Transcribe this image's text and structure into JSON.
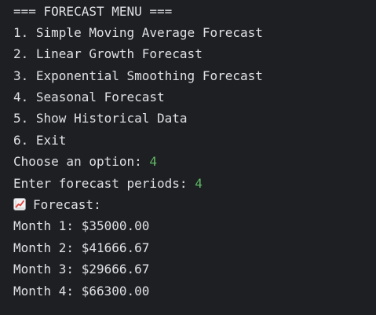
{
  "console": {
    "header": "=== FORECAST MENU ===",
    "menu": [
      "1. Simple Moving Average Forecast",
      "2. Linear Growth Forecast",
      "3. Exponential Smoothing Forecast",
      "4. Seasonal Forecast",
      "5. Show Historical Data",
      "6. Exit"
    ],
    "option_prompt": "Choose an option: ",
    "option_value": "4",
    "periods_prompt": "Enter forecast periods: ",
    "periods_value": "4",
    "forecast_icon": "chart-increasing-icon",
    "forecast_label": "Forecast:",
    "results": [
      "Month 1: $35000.00",
      "Month 2: $41666.67",
      "Month 3: $29666.67",
      "Month 4: $66300.00"
    ]
  },
  "colors": {
    "background": "#1e1f22",
    "text": "#dfe1e5",
    "user_input": "#5fb865"
  }
}
